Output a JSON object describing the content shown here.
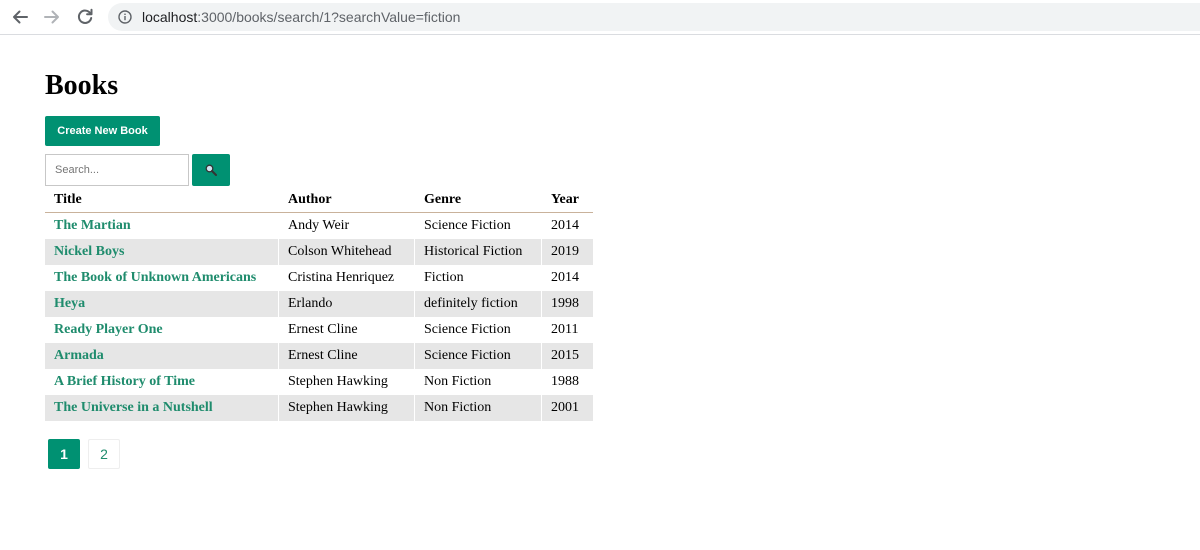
{
  "browser": {
    "url_host": "localhost",
    "url_path": ":3000/books/search/1?searchValue=fiction"
  },
  "page": {
    "title": "Books",
    "create_button_label": "Create New Book",
    "search_placeholder": "Search..."
  },
  "table": {
    "headers": [
      "Title",
      "Author",
      "Genre",
      "Year"
    ],
    "rows": [
      {
        "title": "The Martian",
        "author": "Andy Weir",
        "genre": "Science Fiction",
        "year": "2014"
      },
      {
        "title": "Nickel Boys",
        "author": "Colson Whitehead",
        "genre": "Historical Fiction",
        "year": "2019"
      },
      {
        "title": "The Book of Unknown Americans",
        "author": "Cristina Henriquez",
        "genre": "Fiction",
        "year": "2014"
      },
      {
        "title": "Heya",
        "author": "Erlando",
        "genre": "definitely fiction",
        "year": "1998"
      },
      {
        "title": "Ready Player One",
        "author": "Ernest Cline",
        "genre": "Science Fiction",
        "year": "2011"
      },
      {
        "title": "Armada",
        "author": "Ernest Cline",
        "genre": "Science Fiction",
        "year": "2015"
      },
      {
        "title": "A Brief History of Time",
        "author": "Stephen Hawking",
        "genre": "Non Fiction",
        "year": "1988"
      },
      {
        "title": "The Universe in a Nutshell",
        "author": "Stephen Hawking",
        "genre": "Non Fiction",
        "year": "2001"
      }
    ]
  },
  "pagination": {
    "pages": [
      "1",
      "2"
    ],
    "current": "1"
  },
  "icons": {
    "back": "arrow-left-icon",
    "forward": "arrow-right-icon",
    "reload": "reload-icon",
    "info": "info-icon",
    "search": "magnifier-icon"
  },
  "colors": {
    "accent": "#009172",
    "link": "#1f8c6d",
    "row_stripe": "#e6e6e6",
    "header_rule": "#c9b29b"
  }
}
